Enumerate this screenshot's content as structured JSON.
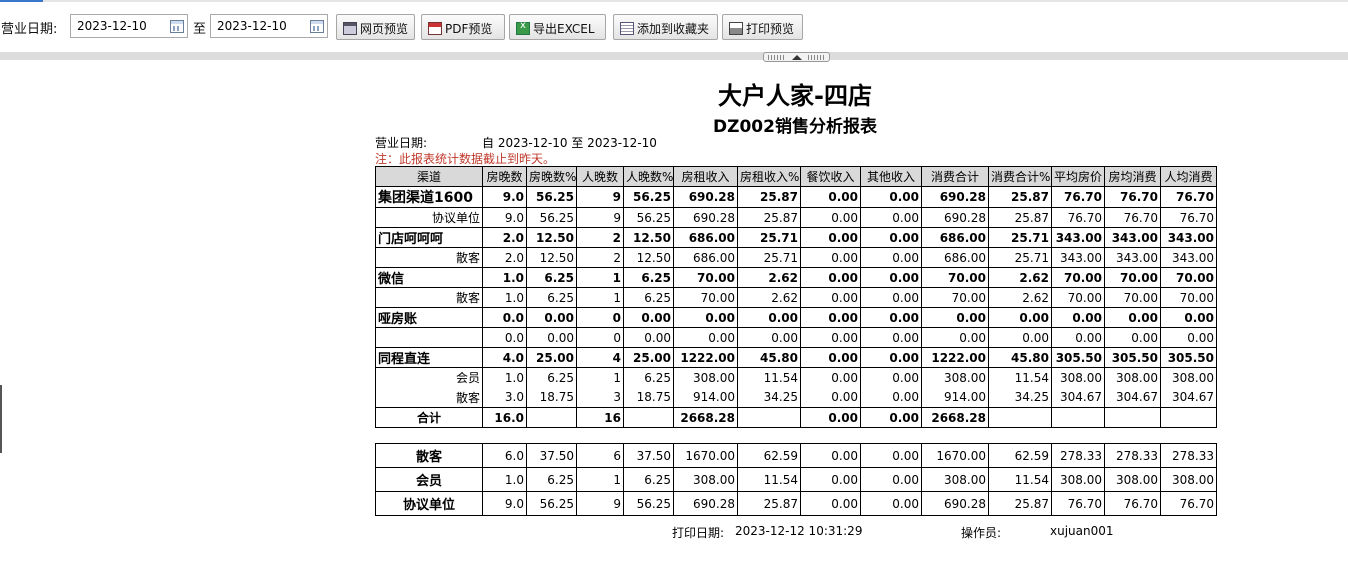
{
  "toolbar": {
    "date_label": "营业日期:",
    "to_label": "至",
    "start_date": "2023-12-10",
    "end_date": "2023-12-10",
    "buttons": [
      {
        "label": "网页预览",
        "icon": "web-preview-icon"
      },
      {
        "label": "PDF预览",
        "icon": "pdf-icon"
      },
      {
        "label": "导出EXCEL",
        "icon": "excel-icon"
      },
      {
        "label": "添加到收藏夹",
        "icon": "favorites-icon"
      },
      {
        "label": "打印预览",
        "icon": "printer-icon"
      }
    ]
  },
  "report": {
    "title": "大户人家-四店",
    "subtitle": "DZ002销售分析报表",
    "date_label": "营业日期:",
    "date_range": "自 2023-12-10 至 2023-12-10",
    "note": "注：此报表统计数据截止到昨天。",
    "note_color": "#c0392b",
    "headers": [
      "渠道",
      "房晚数",
      "房晚数%",
      "人晚数",
      "人晚数%",
      "房租收入",
      "房租收入%",
      "餐饮收入",
      "其他收入",
      "消费合计",
      "消费合计%",
      "平均房价",
      "房均消费",
      "人均消费"
    ],
    "rows": [
      {
        "type": "group",
        "cells": [
          "集团渠道1600",
          "9.0",
          "56.25",
          "9",
          "56.25",
          "690.28",
          "25.87",
          "0.00",
          "0.00",
          "690.28",
          "25.87",
          "76.70",
          "76.70",
          "76.70"
        ]
      },
      {
        "type": "sub",
        "cells": [
          "协议单位",
          "9.0",
          "56.25",
          "9",
          "56.25",
          "690.28",
          "25.87",
          "0.00",
          "0.00",
          "690.28",
          "25.87",
          "76.70",
          "76.70",
          "76.70"
        ]
      },
      {
        "type": "group",
        "cells": [
          "门店呵呵呵",
          "2.0",
          "12.50",
          "2",
          "12.50",
          "686.00",
          "25.71",
          "0.00",
          "0.00",
          "686.00",
          "25.71",
          "343.00",
          "343.00",
          "343.00"
        ]
      },
      {
        "type": "sub",
        "cells": [
          "散客",
          "2.0",
          "12.50",
          "2",
          "12.50",
          "686.00",
          "25.71",
          "0.00",
          "0.00",
          "686.00",
          "25.71",
          "343.00",
          "343.00",
          "343.00"
        ]
      },
      {
        "type": "group",
        "cells": [
          "微信",
          "1.0",
          "6.25",
          "1",
          "6.25",
          "70.00",
          "2.62",
          "0.00",
          "0.00",
          "70.00",
          "2.62",
          "70.00",
          "70.00",
          "70.00"
        ]
      },
      {
        "type": "sub",
        "cells": [
          "散客",
          "1.0",
          "6.25",
          "1",
          "6.25",
          "70.00",
          "2.62",
          "0.00",
          "0.00",
          "70.00",
          "2.62",
          "70.00",
          "70.00",
          "70.00"
        ]
      },
      {
        "type": "group",
        "cells": [
          "哑房账",
          "0.0",
          "0.00",
          "0",
          "0.00",
          "0.00",
          "0.00",
          "0.00",
          "0.00",
          "0.00",
          "0.00",
          "0.00",
          "0.00",
          "0.00"
        ]
      },
      {
        "type": "sub",
        "cells": [
          "",
          "0.0",
          "0.00",
          "0",
          "0.00",
          "0.00",
          "0.00",
          "0.00",
          "0.00",
          "0.00",
          "0.00",
          "0.00",
          "0.00",
          "0.00"
        ]
      },
      {
        "type": "group",
        "cells": [
          "同程直连",
          "4.0",
          "25.00",
          "4",
          "25.00",
          "1222.00",
          "45.80",
          "0.00",
          "0.00",
          "1222.00",
          "45.80",
          "305.50",
          "305.50",
          "305.50"
        ]
      },
      {
        "type": "sub-nb",
        "cells": [
          "会员",
          "1.0",
          "6.25",
          "1",
          "6.25",
          "308.00",
          "11.54",
          "0.00",
          "0.00",
          "308.00",
          "11.54",
          "308.00",
          "308.00",
          "308.00"
        ]
      },
      {
        "type": "sub",
        "cells": [
          "散客",
          "3.0",
          "18.75",
          "3",
          "18.75",
          "914.00",
          "34.25",
          "0.00",
          "0.00",
          "914.00",
          "34.25",
          "304.67",
          "304.67",
          "304.67"
        ]
      },
      {
        "type": "total",
        "cells": [
          "合计",
          "16.0",
          "",
          "16",
          "",
          "2668.28",
          "",
          "0.00",
          "0.00",
          "2668.28",
          "",
          "",
          "",
          ""
        ]
      }
    ],
    "summary": [
      [
        "散客",
        "6.0",
        "37.50",
        "6",
        "37.50",
        "1670.00",
        "62.59",
        "0.00",
        "0.00",
        "1670.00",
        "62.59",
        "278.33",
        "278.33",
        "278.33"
      ],
      [
        "会员",
        "1.0",
        "6.25",
        "1",
        "6.25",
        "308.00",
        "11.54",
        "0.00",
        "0.00",
        "308.00",
        "11.54",
        "308.00",
        "308.00",
        "308.00"
      ],
      [
        "协议单位",
        "9.0",
        "56.25",
        "9",
        "56.25",
        "690.28",
        "25.87",
        "0.00",
        "0.00",
        "690.28",
        "25.87",
        "76.70",
        "76.70",
        "76.70"
      ]
    ],
    "print_date_label": "打印日期:",
    "print_date": "2023-12-12 10:31:29",
    "operator_label": "操作员:",
    "operator": "xujuan001"
  }
}
